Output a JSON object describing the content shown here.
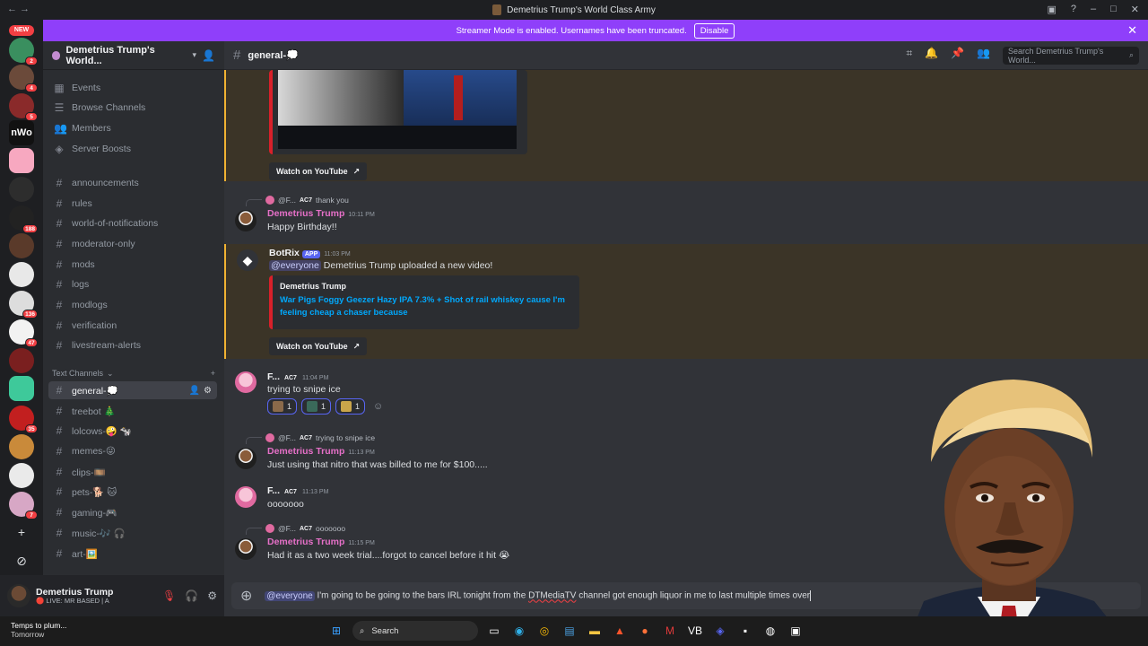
{
  "window": {
    "title": "Demetrius Trump's World Class Army"
  },
  "streamer_bar": {
    "message": "Streamer Mode is enabled. Usernames have been truncated.",
    "button": "Disable"
  },
  "rail": {
    "new_label": "NEW",
    "badges": [
      "2",
      "4",
      "5",
      "188",
      "136",
      "47",
      "35",
      "7"
    ]
  },
  "server": {
    "name": "Demetrius Trump's World..."
  },
  "sidebar": {
    "top_items": [
      "Events",
      "Browse Channels",
      "Members",
      "Server Boosts"
    ],
    "info_channels": [
      "announcements",
      "rules",
      "world-of-notifications",
      "moderator-only",
      "mods",
      "logs",
      "modlogs",
      "verification",
      "livestream-alerts"
    ],
    "category": "Text Channels",
    "text_channels": [
      "general-💭",
      "treebot 🎄",
      "lolcows-🤪 🐄",
      "memes-😜",
      "clips-🎞️",
      "pets-🐕 🐱",
      "gaming-🎮",
      "music-🎶 🎧",
      "art-🖼️"
    ]
  },
  "user": {
    "name": "Demetrius Trump",
    "status": "🔴 LIVE: MR BASED | A"
  },
  "channel": {
    "name": "general-💭",
    "search_placeholder": "Search Demetrius Trump's World..."
  },
  "messages": {
    "watch_label": "Watch on YouTube",
    "ac7": "AC7",
    "m1": {
      "reply_user": "@F...",
      "reply_text": "thank you",
      "author": "Demetrius Trump",
      "time": "10:11 PM",
      "text": "Happy Birthday!!"
    },
    "m2": {
      "author": "BotRix",
      "app": "APP",
      "time": "11:03 PM",
      "mention": "@everyone",
      "text": "Demetrius Trump uploaded a new video!",
      "embed_author": "Demetrius Trump",
      "embed_title": "War Pigs Foggy Geezer Hazy IPA 7.3% + Shot of rail whiskey cause I'm feeling cheap a chaser because"
    },
    "m3": {
      "author": "F...",
      "time": "11:04 PM",
      "text": "trying to snipe ice",
      "reactions": [
        "1",
        "1",
        "1"
      ]
    },
    "m4": {
      "reply_user": "@F...",
      "reply_text": "trying to snipe ice",
      "author": "Demetrius Trump",
      "time": "11:13 PM",
      "text": "Just using that nitro that was billed to me for $100....."
    },
    "m5": {
      "author": "F...",
      "time": "11:13 PM",
      "text": "ooooooo"
    },
    "m6": {
      "reply_user": "@F...",
      "reply_text": "ooooooo",
      "author": "Demetrius Trump",
      "time": "11:15 PM",
      "text": "Had it as a two week trial....forgot to cancel before it hit 😭"
    }
  },
  "composer": {
    "mention": "@everyone",
    "text_a": "I'm going to be going to the bars IRL tonight from the",
    "text_misspelled": "DTMediaTV",
    "text_b": "channel got enough liquor in me to last multiple times over"
  },
  "taskbar": {
    "weather_title": "Temps to plum...",
    "weather_sub": "Tomorrow",
    "search": "Search"
  },
  "colors": {
    "accent": "#8f3ffa",
    "name_pink": "#e670c8",
    "mention": "#5865f2",
    "highlight": "#f0b232"
  }
}
